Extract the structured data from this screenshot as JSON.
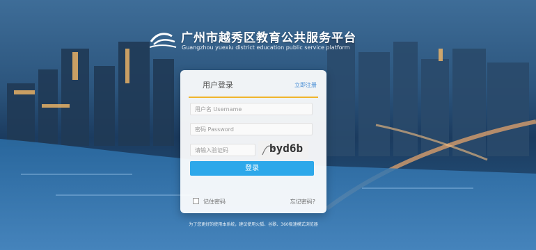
{
  "brand": {
    "title": "广州市越秀区教育公共服务平台",
    "subtitle": "Guangzhou yuexiu district education public service platform"
  },
  "login": {
    "title": "用户登录",
    "register_link": "立即注册",
    "username_placeholder": "用户名 Username",
    "password_placeholder": "密码 Password",
    "captcha_placeholder": "请输入验证码",
    "captcha_code": "byd6b",
    "submit_label": "登录",
    "remember_label": "记住密码",
    "forgot_label": "忘记密码?"
  },
  "footer": {
    "note": "为了您更好的使用本系统，建议使用火狐、谷歌、360极速模式浏览器"
  },
  "colors": {
    "accent": "#2da8ea",
    "underline": "#f0b52c",
    "link": "#4a8fd6"
  }
}
